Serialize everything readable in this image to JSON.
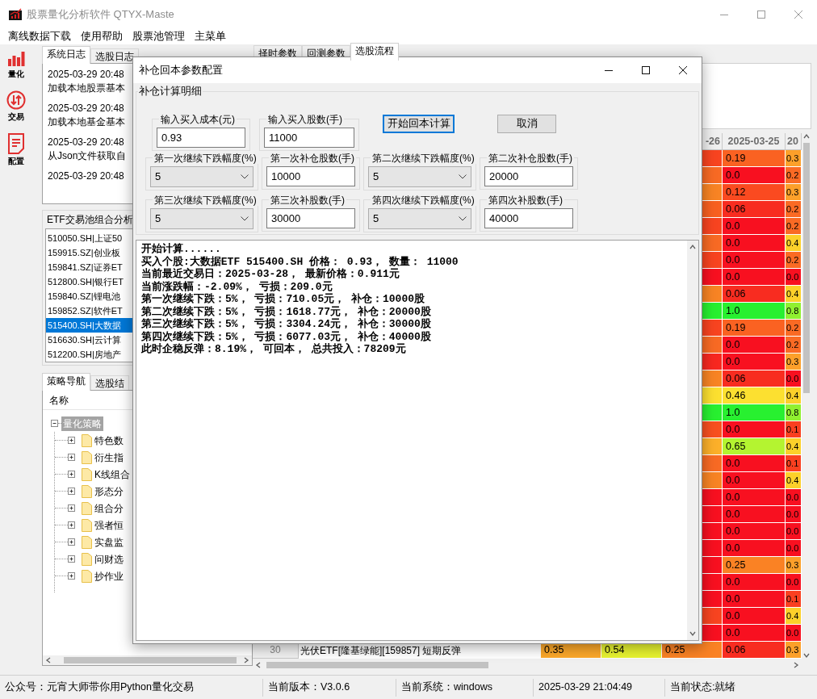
{
  "window": {
    "title": "股票量化分析软件 QTYX-Maste"
  },
  "menu": [
    "离线数据下载",
    "使用帮助",
    "股票池管理",
    "主菜单"
  ],
  "sidebar": [
    {
      "label": "量化",
      "kind": "chart"
    },
    {
      "label": "交易",
      "kind": "trade"
    },
    {
      "label": "配置",
      "kind": "config"
    }
  ],
  "log_tabs": [
    {
      "label": "系统日志",
      "selected": true
    },
    {
      "label": "选股日志",
      "selected": false
    }
  ],
  "log": [
    {
      "time": "2025-03-29 20:48",
      "message": "加载本地股票基本"
    },
    {
      "time": "2025-03-29 20:48",
      "message": "加载本地基金基本"
    },
    {
      "time": "2025-03-29 20:48",
      "message": "从Json文件获取自"
    },
    {
      "time": "2025-03-29 20:48"
    }
  ],
  "etf_pool": {
    "title": "ETF交易池组合分析",
    "items": [
      {
        "label": "510050.SH|上证50",
        "selected": false
      },
      {
        "label": "159915.SZ|创业板",
        "selected": false
      },
      {
        "label": "159841.SZ|证券ET",
        "selected": false
      },
      {
        "label": "512800.SH|银行ET",
        "selected": false
      },
      {
        "label": "159840.SZ|锂电池",
        "selected": false
      },
      {
        "label": "159852.SZ|软件ET",
        "selected": false
      },
      {
        "label": "515400.SH|大数据",
        "selected": true
      },
      {
        "label": "516630.SH|云计算",
        "selected": false
      },
      {
        "label": "512200.SH|房地产",
        "selected": false
      }
    ]
  },
  "nav_tabs": [
    {
      "label": "策略导航",
      "selected": true
    },
    {
      "label": "选股结",
      "selected": false
    }
  ],
  "tree": {
    "header": "名称",
    "root": {
      "label": "量化策略",
      "expanded": true,
      "children": [
        {
          "label": "特色数",
          "expanded": false
        },
        {
          "label": "衍生指",
          "expanded": false
        },
        {
          "label": "K线组合",
          "expanded": false
        },
        {
          "label": "形态分",
          "expanded": false
        },
        {
          "label": "组合分",
          "expanded": false
        },
        {
          "label": "强者恒",
          "expanded": false
        },
        {
          "label": "实盘监",
          "expanded": false
        },
        {
          "label": "问财选",
          "expanded": false
        },
        {
          "label": "抄作业",
          "expanded": false
        }
      ]
    }
  },
  "param_tabs": [
    {
      "label": "择时参数",
      "selected": false
    },
    {
      "label": "回测参数",
      "selected": false
    },
    {
      "label": "选股流程",
      "selected": true
    }
  ],
  "table": {
    "columns": [
      "-26",
      "2025-03-25",
      "20"
    ],
    "rows": [
      {
        "cells": [
          {
            "color": "#f84420"
          },
          {
            "text": "0.19",
            "color": "#fa6222"
          },
          {
            "text": "0.3",
            "color": "#fca02a"
          }
        ]
      },
      {
        "cells": [
          {
            "color": "#f86a24"
          },
          {
            "text": "0.0",
            "color": "#f81020"
          },
          {
            "text": "0.2",
            "color": "#fa6a24"
          }
        ]
      },
      {
        "cells": [
          {
            "color": "#f88424"
          },
          {
            "text": "0.12",
            "color": "#fa4a20"
          },
          {
            "text": "0.3",
            "color": "#fca02a"
          }
        ]
      },
      {
        "cells": [
          {
            "color": "#f86020"
          },
          {
            "text": "0.06",
            "color": "#f82c20"
          },
          {
            "text": "0.2",
            "color": "#fa6a24"
          }
        ]
      },
      {
        "cells": [
          {
            "color": "#f84420"
          },
          {
            "text": "0.0",
            "color": "#f81020"
          },
          {
            "text": "0.2",
            "color": "#fa6a24"
          }
        ]
      },
      {
        "cells": [
          {
            "color": "#f86a24"
          },
          {
            "text": "0.0",
            "color": "#f81020"
          },
          {
            "text": "0.4",
            "color": "#fcd02a"
          }
        ]
      },
      {
        "cells": [
          {
            "color": "#f84420"
          },
          {
            "text": "0.0",
            "color": "#f81020"
          },
          {
            "text": "0.2",
            "color": "#fa6a24"
          }
        ]
      },
      {
        "cells": [
          {
            "color": "#f81020"
          },
          {
            "text": "0.0",
            "color": "#f81020"
          },
          {
            "text": "0.0",
            "color": "#f81020"
          }
        ]
      },
      {
        "cells": [
          {
            "color": "#f88424"
          },
          {
            "text": "0.06",
            "color": "#f82c20"
          },
          {
            "text": "0.4",
            "color": "#fcd02a"
          }
        ]
      },
      {
        "cells": [
          {
            "color": "#28f030"
          },
          {
            "text": "1.0",
            "color": "#28f030"
          },
          {
            "text": "0.8",
            "color": "#90f030"
          }
        ]
      },
      {
        "cells": [
          {
            "color": "#f84420"
          },
          {
            "text": "0.19",
            "color": "#fa6222"
          },
          {
            "text": "0.2",
            "color": "#fa6a24"
          }
        ]
      },
      {
        "cells": [
          {
            "color": "#f86a24"
          },
          {
            "text": "0.0",
            "color": "#f81020"
          },
          {
            "text": "0.2",
            "color": "#fa6a24"
          }
        ]
      },
      {
        "cells": [
          {
            "color": "#f82820"
          },
          {
            "text": "0.0",
            "color": "#f81020"
          },
          {
            "text": "0.3",
            "color": "#fca02a"
          }
        ]
      },
      {
        "cells": [
          {
            "color": "#f88424"
          },
          {
            "text": "0.06",
            "color": "#f82c20"
          },
          {
            "text": "0.0",
            "color": "#f81020"
          }
        ]
      },
      {
        "cells": [
          {
            "color": "#fce030"
          },
          {
            "text": "0.46",
            "color": "#fce030"
          },
          {
            "text": "0.4",
            "color": "#fcd02a"
          }
        ]
      },
      {
        "cells": [
          {
            "color": "#28f030"
          },
          {
            "text": "1.0",
            "color": "#28f030"
          },
          {
            "text": "0.8",
            "color": "#90f030"
          }
        ]
      },
      {
        "cells": [
          {
            "color": "#f85020"
          },
          {
            "text": "0.0",
            "color": "#f81020"
          },
          {
            "text": "0.1",
            "color": "#fa4020"
          }
        ]
      },
      {
        "cells": [
          {
            "color": "#fcb02a"
          },
          {
            "text": "0.65",
            "color": "#b4f430"
          },
          {
            "text": "0.4",
            "color": "#fcd02a"
          }
        ]
      },
      {
        "cells": [
          {
            "color": "#f86a24"
          },
          {
            "text": "0.0",
            "color": "#f81020"
          },
          {
            "text": "0.1",
            "color": "#fa4020"
          }
        ]
      },
      {
        "cells": [
          {
            "color": "#f88424"
          },
          {
            "text": "0.0",
            "color": "#f81020"
          },
          {
            "text": "0.4",
            "color": "#fcd02a"
          }
        ]
      },
      {
        "cells": [
          {
            "color": "#f81020"
          },
          {
            "text": "0.0",
            "color": "#f81020"
          },
          {
            "text": "0.0",
            "color": "#f81020"
          }
        ]
      },
      {
        "cells": [
          {
            "color": "#f81020"
          },
          {
            "text": "0.0",
            "color": "#f81020"
          },
          {
            "text": "0.0",
            "color": "#f81020"
          }
        ]
      },
      {
        "cells": [
          {
            "color": "#f81020"
          },
          {
            "text": "0.0",
            "color": "#f81020"
          },
          {
            "text": "0.0",
            "color": "#f81020"
          }
        ]
      },
      {
        "cells": [
          {
            "color": "#f81020"
          },
          {
            "text": "0.0",
            "color": "#f81020"
          },
          {
            "text": "0.0",
            "color": "#f81020"
          }
        ]
      },
      {
        "cells": [
          {
            "color": "#f81020"
          },
          {
            "text": "0.25",
            "color": "#fa8224"
          },
          {
            "text": "0.3",
            "color": "#fca02a"
          }
        ]
      },
      {
        "cells": [
          {
            "color": "#f81020"
          },
          {
            "text": "0.0",
            "color": "#f81020"
          },
          {
            "text": "0.0",
            "color": "#f81020"
          }
        ]
      },
      {
        "cells": [
          {
            "color": "#f81020"
          },
          {
            "text": "0.0",
            "color": "#f81020"
          },
          {
            "text": "0.1",
            "color": "#fa4020"
          }
        ]
      },
      {
        "cells": [
          {
            "color": "#f84420"
          },
          {
            "text": "0.0",
            "color": "#f81020"
          },
          {
            "text": "0.4",
            "color": "#fcd02a"
          }
        ]
      },
      {
        "cells": [
          {
            "color": "#f81020"
          },
          {
            "text": "0.0",
            "color": "#f81020"
          },
          {
            "text": "0.0",
            "color": "#f81020"
          }
        ]
      },
      {
        "number": "30",
        "name": "光伏ETF[隆基绿能][159857] 短期反弹",
        "cells": [
          {
            "text": "0.35",
            "color": "#fca82a"
          },
          {
            "text": "0.54",
            "color": "#e8f430"
          },
          {
            "text": "0.25",
            "color": "#fa8224"
          },
          {
            "text": "0.06",
            "color": "#f82c20"
          },
          {
            "text": "0.3",
            "color": "#fca02a"
          }
        ]
      }
    ]
  },
  "dialog": {
    "title": "补仓回本参数配置",
    "group": "补仓计算明细",
    "fields": [
      {
        "label": "输入买入成本(元)",
        "kind": "input",
        "value": "0.93"
      },
      {
        "label": "输入买入股数(手)",
        "kind": "input",
        "value": "11000"
      },
      {
        "label": "第一次继续下跌幅度(%)",
        "kind": "combo",
        "value": "5"
      },
      {
        "label": "第一次补仓股数(手)",
        "kind": "input",
        "value": "10000"
      },
      {
        "label": "第二次继续下跌幅度(%)",
        "kind": "combo",
        "value": "5"
      },
      {
        "label": "第二次补仓股数(手)",
        "kind": "input",
        "value": "20000"
      },
      {
        "label": "第三次继续下跌幅度(%)",
        "kind": "combo",
        "value": "5"
      },
      {
        "label": "第三次补股数(手)",
        "kind": "input",
        "value": "30000"
      },
      {
        "label": "第四次继续下跌幅度(%)",
        "kind": "combo",
        "value": "5"
      },
      {
        "label": "第四次补股数(手)",
        "kind": "input",
        "value": "40000"
      }
    ],
    "buttons": [
      {
        "label": "开始回本计算",
        "focused": true
      },
      {
        "label": "取消",
        "focused": false
      }
    ],
    "output": [
      "开始计算......",
      "买入个股:大数据ETF 515400.SH 价格： 0.93， 数量： 11000",
      "当前最近交易日：2025-03-28， 最新价格：0.911元",
      "当前涨跌幅：-2.09%， 亏损：209.0元",
      "第一次继续下跌：5%， 亏损：710.05元， 补仓：10000股",
      "第二次继续下跌：5%， 亏损：1618.77元， 补仓：20000股",
      "第三次继续下跌：5%， 亏损：3304.24元， 补仓：30000股",
      "第四次继续下跌：5%， 亏损：6077.03元， 补仓：40000股",
      "此时企稳反弹：8.19%， 可回本， 总共投入：78209元"
    ]
  },
  "status_bar": [
    "公众号：元宵大师带你用Python量化交易",
    "当前版本：V3.0.6",
    "当前系统：windows",
    "2025-03-29 21:04:49",
    "当前状态:就绪"
  ]
}
